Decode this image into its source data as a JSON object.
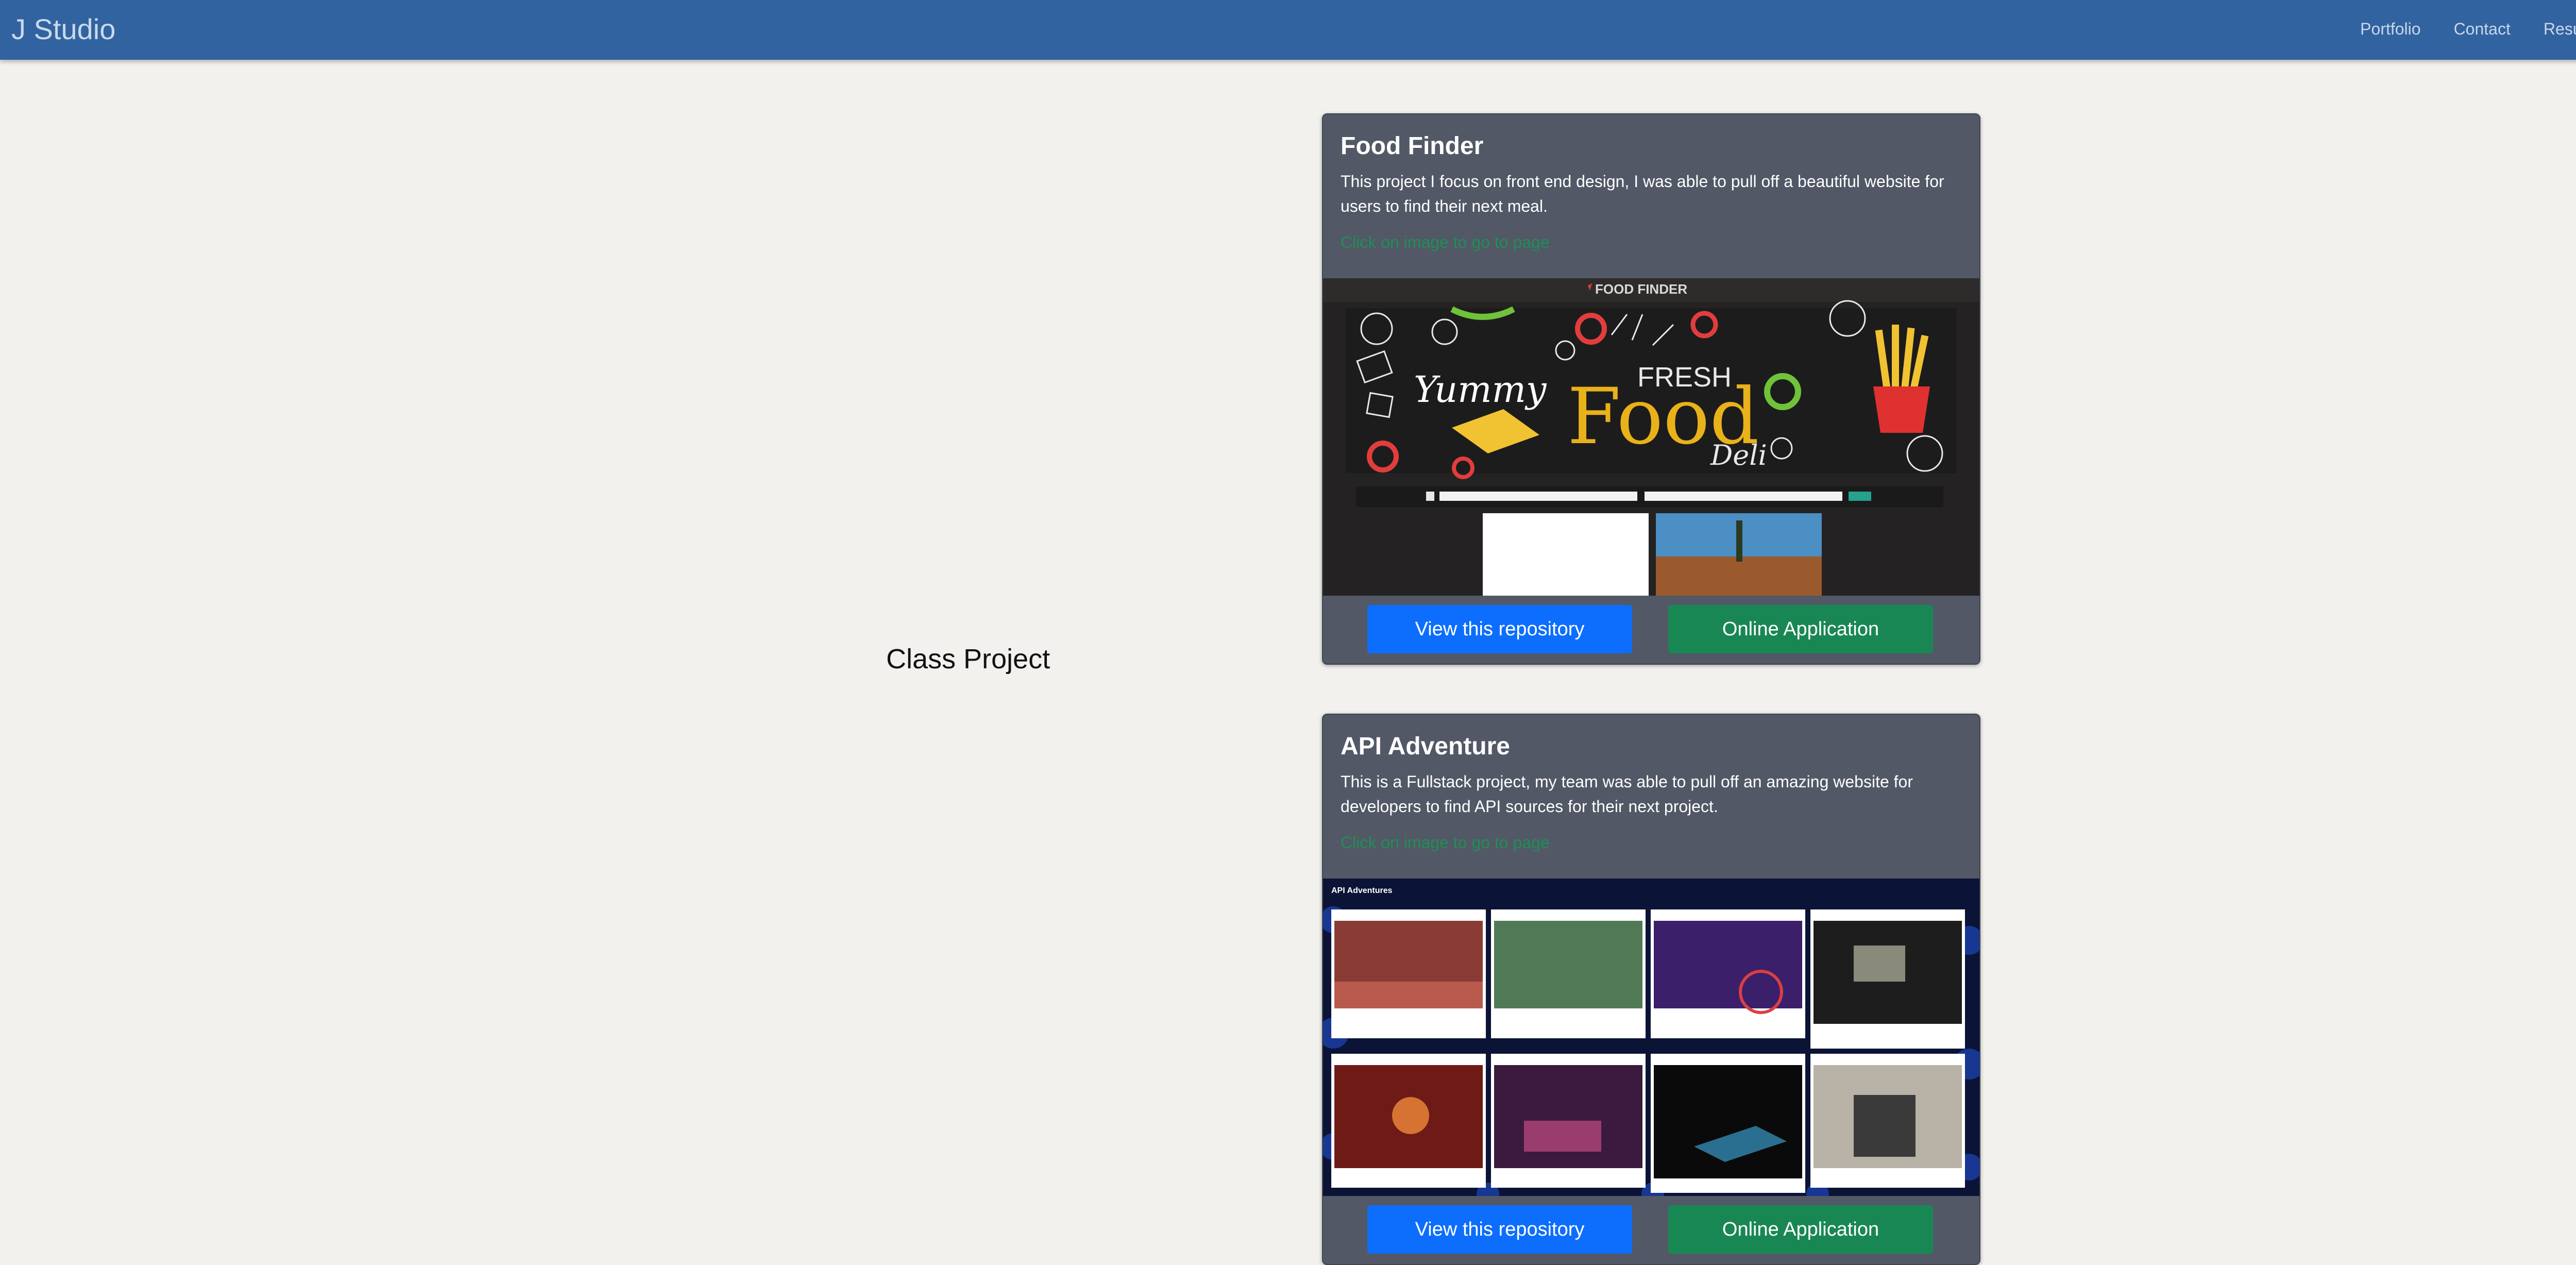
{
  "nav": {
    "brand": "J Studio",
    "links": [
      "Portfolio",
      "Contact",
      "Resume"
    ]
  },
  "section_title": "Class Project",
  "cards": [
    {
      "title": "Food Finder",
      "description": "This project I focus on front end design, I was able to pull off a beautiful website for users to find their next meal.",
      "hint": "Click on image to go to page",
      "image_header": "FOOD FINDER",
      "image_words": {
        "yummy": "Yummy",
        "fresh": "FRESH",
        "food": "Food",
        "deli": "Deli"
      },
      "repo_button": "View this repository",
      "app_button": "Online Application"
    },
    {
      "title": "API Adventure",
      "description": "This is a Fullstack project, my team was able to pull off an amazing website for developers to find API sources for their next project.",
      "hint": "Click on image to go to page",
      "image_header": "API Adventures",
      "repo_button": "View this repository",
      "app_button": "Online Application"
    }
  ],
  "colors": {
    "navbar": "#3163a0",
    "page_background": "#f2f1ee",
    "card_background": "#525866",
    "primary_button": "#0d6efd",
    "success_button": "#198754",
    "hint_text": "#1e8f55"
  }
}
